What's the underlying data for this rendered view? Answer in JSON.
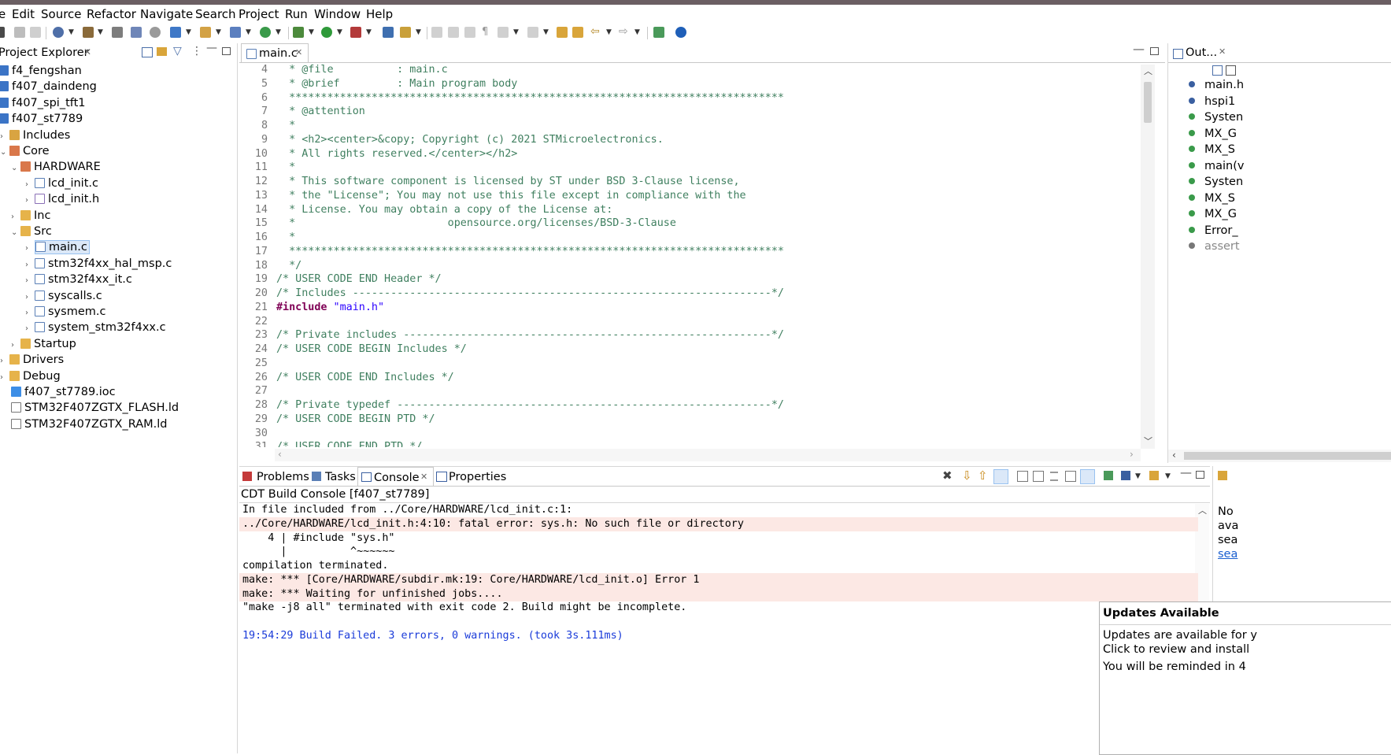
{
  "menu": [
    "e",
    "Edit",
    "Source",
    "Refactor",
    "Navigate",
    "Search",
    "Project",
    "Run",
    "Window",
    "Help"
  ],
  "project_explorer": {
    "title": "Project Explorer",
    "items": [
      {
        "label": "f4_fengshan",
        "icon": "project-icon"
      },
      {
        "label": "f407_daindeng",
        "icon": "project-icon"
      },
      {
        "label": "f407_spi_tft1",
        "icon": "project-icon"
      },
      {
        "label": "f407_st7789",
        "icon": "project-icon"
      },
      {
        "label": "Includes",
        "icon": "includes-icon"
      },
      {
        "label": "Core",
        "icon": "source-folder-icon"
      },
      {
        "label": "HARDWARE",
        "icon": "source-folder-icon"
      },
      {
        "label": "lcd_init.c",
        "icon": "c-file-icon"
      },
      {
        "label": "lcd_init.h",
        "icon": "h-file-icon"
      },
      {
        "label": "Inc",
        "icon": "folder-icon"
      },
      {
        "label": "Src",
        "icon": "folder-icon"
      },
      {
        "label": "main.c",
        "icon": "c-file-icon"
      },
      {
        "label": "stm32f4xx_hal_msp.c",
        "icon": "c-file-icon"
      },
      {
        "label": "stm32f4xx_it.c",
        "icon": "c-file-icon"
      },
      {
        "label": "syscalls.c",
        "icon": "c-file-icon"
      },
      {
        "label": "sysmem.c",
        "icon": "c-file-icon"
      },
      {
        "label": "system_stm32f4xx.c",
        "icon": "c-file-icon"
      },
      {
        "label": "Startup",
        "icon": "folder-icon"
      },
      {
        "label": "Drivers",
        "icon": "folder-icon"
      },
      {
        "label": "Debug",
        "icon": "folder-icon"
      },
      {
        "label": "f407_st7789.ioc",
        "icon": "mx-file-icon"
      },
      {
        "label": "STM32F407ZGTX_FLASH.ld",
        "icon": "ld-file-icon"
      },
      {
        "label": "STM32F407ZGTX_RAM.ld",
        "icon": "ld-file-icon"
      }
    ]
  },
  "editor": {
    "tab": "main.c",
    "lines": [
      {
        "n": "4",
        "t": "  * @file          : main.c"
      },
      {
        "n": "5",
        "t": "  * @brief         : Main program body"
      },
      {
        "n": "6",
        "t": "  ******************************************************************************"
      },
      {
        "n": "7",
        "t": "  * @attention"
      },
      {
        "n": "8",
        "t": "  *"
      },
      {
        "n": "9",
        "t": "  * <h2><center>&copy; Copyright (c) 2021 STMicroelectronics."
      },
      {
        "n": "10",
        "t": "  * All rights reserved.</center></h2>"
      },
      {
        "n": "11",
        "t": "  *"
      },
      {
        "n": "12",
        "t": "  * This software component is licensed by ST under BSD 3-Clause license,"
      },
      {
        "n": "13",
        "t": "  * the \"License\"; You may not use this file except in compliance with the"
      },
      {
        "n": "14",
        "t": "  * License. You may obtain a copy of the License at:"
      },
      {
        "n": "15",
        "t": "  *                        opensource.org/licenses/BSD-3-Clause"
      },
      {
        "n": "16",
        "t": "  *"
      },
      {
        "n": "17",
        "t": "  ******************************************************************************"
      },
      {
        "n": "18",
        "t": "  */"
      },
      {
        "n": "19",
        "t": "/* USER CODE END Header */"
      },
      {
        "n": "20",
        "t": "/* Includes ------------------------------------------------------------------*/"
      },
      {
        "n": "21",
        "t": "#include \"main.h\""
      },
      {
        "n": "22",
        "t": ""
      },
      {
        "n": "23",
        "t": "/* Private includes ----------------------------------------------------------*/"
      },
      {
        "n": "24",
        "t": "/* USER CODE BEGIN Includes */"
      },
      {
        "n": "25",
        "t": ""
      },
      {
        "n": "26",
        "t": "/* USER CODE END Includes */"
      },
      {
        "n": "27",
        "t": ""
      },
      {
        "n": "28",
        "t": "/* Private typedef -----------------------------------------------------------*/"
      },
      {
        "n": "29",
        "t": "/* USER CODE BEGIN PTD */"
      },
      {
        "n": "30",
        "t": ""
      },
      {
        "n": "31",
        "t": "/* USER CODE END PTD */"
      }
    ]
  },
  "outline": {
    "title": "Out...",
    "items": [
      "main.h",
      "hspi1",
      "Systen",
      "MX_G",
      "MX_S",
      "main(v",
      "Systen",
      "MX_S",
      "MX_G",
      "Error_",
      "assert"
    ]
  },
  "console": {
    "tabs": [
      "Problems",
      "Tasks",
      "Console",
      "Properties"
    ],
    "header": "CDT Build Console [f407_st7789]",
    "lines": [
      {
        "t": "In file included from ../Core/HARDWARE/lcd_init.c:1:",
        "kind": "normal"
      },
      {
        "t": "../Core/HARDWARE/lcd_init.h:4:10: fatal error: sys.h: No such file or directory",
        "kind": "error"
      },
      {
        "t": "    4 | #include \"sys.h\"",
        "kind": "normal"
      },
      {
        "t": "      |          ^~~~~~~",
        "kind": "normal"
      },
      {
        "t": "compilation terminated.",
        "kind": "normal"
      },
      {
        "t": "make: *** [Core/HARDWARE/subdir.mk:19: Core/HARDWARE/lcd_init.o] Error 1",
        "kind": "error"
      },
      {
        "t": "make: *** Waiting for unfinished jobs....",
        "kind": "error"
      },
      {
        "t": "\"make -j8 all\" terminated with exit code 2. Build might be incomplete.",
        "kind": "normal"
      },
      {
        "t": "",
        "kind": "normal"
      },
      {
        "t": "19:54:29 Build Failed. 3 errors, 0 warnings. (took 3s.111ms)",
        "kind": "status"
      }
    ]
  },
  "right_panel": {
    "lines": [
      "No",
      "ava",
      "sea"
    ],
    "link": "sea"
  },
  "updates_popup": {
    "title": "Updates Available",
    "line1": "Updates are available for y",
    "line2": "Click to review and install",
    "line3": "You will be reminded in 4"
  },
  "colors": {
    "comment": "#3f7f5f",
    "keyword": "#7f0055",
    "string": "#2a00ff",
    "error_bg": "#fce8e4",
    "status_blue": "#1a3bd9"
  }
}
